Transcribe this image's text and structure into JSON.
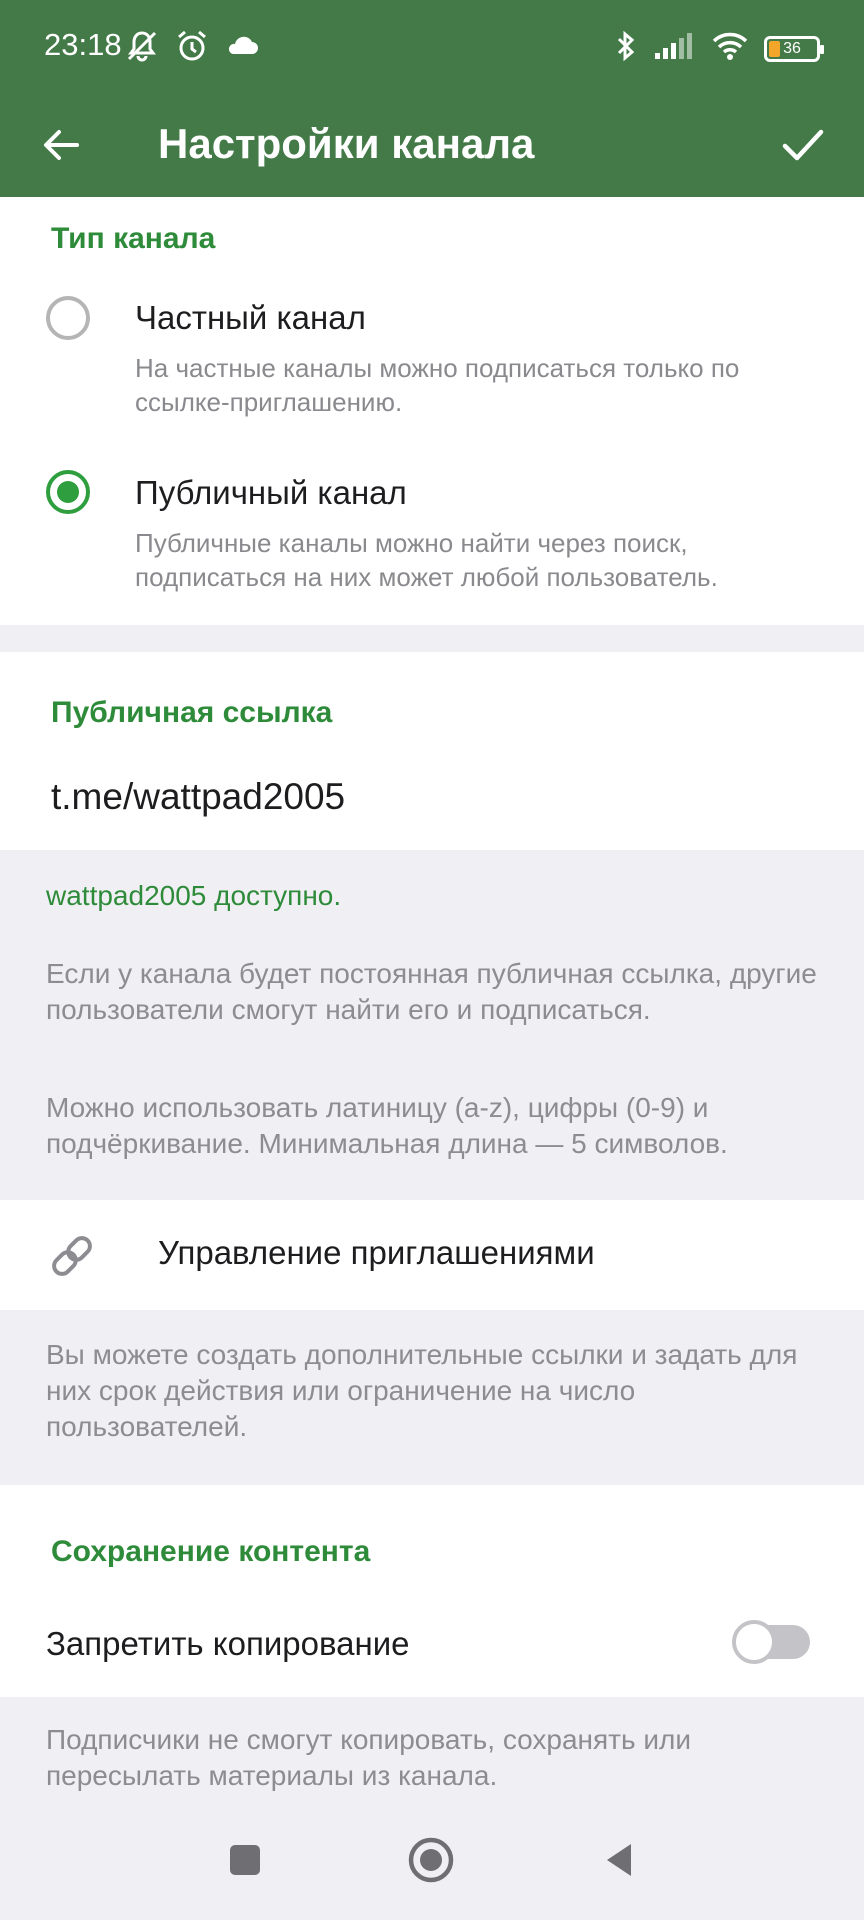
{
  "status_bar": {
    "time": "23:18",
    "battery": "36",
    "icons_left": [
      "mute-alert-icon",
      "alarm-icon",
      "cloud-icon"
    ],
    "icons_right": [
      "bluetooth-icon",
      "signal-icon",
      "wifi-icon",
      "battery-icon"
    ]
  },
  "app_bar": {
    "title": "Настройки канала",
    "back_icon": "arrow-left-icon",
    "done_icon": "checkmark-icon",
    "color": "#437a48"
  },
  "channel_type": {
    "title": "Тип канала",
    "options": [
      {
        "label": "Частный канал",
        "description": "На частные каналы можно подписаться только по ссылке-приглашению.",
        "selected": false
      },
      {
        "label": "Публичный канал",
        "description": "Публичные каналы можно найти через поиск, подписаться на них может любой пользователь.",
        "selected": true
      }
    ]
  },
  "public_link": {
    "title": "Публичная ссылка",
    "value": "t.me/wattpad2005",
    "availability": "wattpad2005 доступно.",
    "info_1": "Если у канала будет постоянная публичная ссылка, другие пользователи смогут найти его и подписаться.",
    "info_2": "Можно использовать латиницу (a-z), цифры (0-9) и подчёркивание. Минимальная длина — 5 символов."
  },
  "invites": {
    "label": "Управление приглашениями",
    "icon": "link-icon",
    "info": "Вы можете создать дополнительные ссылки и задать для них срок действия или ограничение на число пользователей."
  },
  "content_protection": {
    "title": "Сохранение контента",
    "toggle_label": "Запретить копирование",
    "enabled": false,
    "info": "Подписчики не смогут копировать, сохранять или пересылать материалы из канала."
  },
  "nav_bar": {
    "buttons": [
      "recents-square-icon",
      "home-circle-icon",
      "back-triangle-icon"
    ]
  },
  "colors": {
    "accent": "#2e8b3a",
    "radio_active": "#2e9e3e",
    "background": "#f0eff3"
  }
}
